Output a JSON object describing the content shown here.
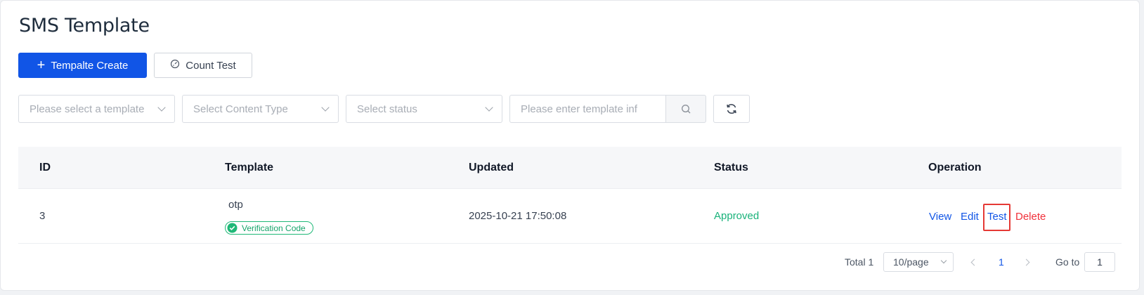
{
  "page": {
    "title": "SMS Template"
  },
  "toolbar": {
    "create_label": "Tempalte Create",
    "count_test_label": "Count Test"
  },
  "filters": {
    "template_placeholder": "Please select a template",
    "content_type_placeholder": "Select Content Type",
    "status_placeholder": "Select status",
    "search_placeholder": "Please enter template inf"
  },
  "table": {
    "headers": {
      "id": "ID",
      "template": "Template",
      "updated": "Updated",
      "status": "Status",
      "operation": "Operation"
    },
    "rows": [
      {
        "id": "3",
        "template_name": "otp",
        "badge": "Verification Code",
        "updated": "2025-10-21 17:50:08",
        "status": "Approved",
        "ops": {
          "view": "View",
          "edit": "Edit",
          "test": "Test",
          "delete": "Delete"
        }
      }
    ]
  },
  "pagination": {
    "total": "Total 1",
    "page_size": "10/page",
    "current_page": "1",
    "goto_label": "Go to",
    "goto_value": "1"
  },
  "colors": {
    "primary": "#1155e6",
    "success": "#19b27a",
    "danger": "#f0303a",
    "highlight": "#e53935"
  }
}
